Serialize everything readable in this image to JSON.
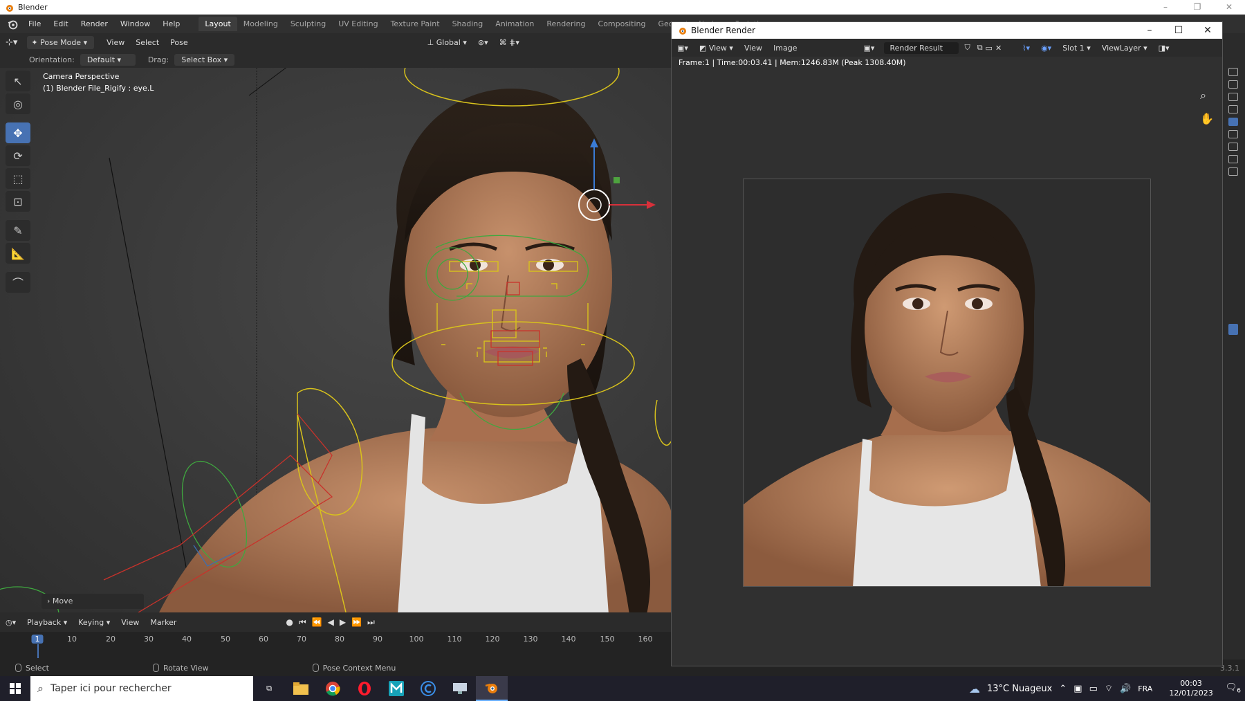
{
  "os": {
    "title": "Blender",
    "controls": [
      "–",
      "❐",
      "✕"
    ]
  },
  "menubar": {
    "menus": [
      "File",
      "Edit",
      "Render",
      "Window",
      "Help"
    ],
    "workspaces": [
      "Layout",
      "Modeling",
      "Sculpting",
      "UV Editing",
      "Texture Paint",
      "Shading",
      "Animation",
      "Rendering",
      "Compositing",
      "Geometry Nodes",
      "Scriptin"
    ],
    "active_workspace": "Layout"
  },
  "viewport": {
    "mode": "Pose Mode",
    "header_menus": [
      "View",
      "Select",
      "Pose"
    ],
    "transform_orientation": "Global",
    "orientation_label": "Orientation:",
    "orientation_value": "Default",
    "drag_label": "Drag:",
    "drag_value": "Select Box",
    "info_line1": "Camera Perspective",
    "info_line2": "(1) Blender File_Rigify : eye.L",
    "last_op": "Move"
  },
  "toolbar": {
    "tools": [
      {
        "name": "select-box-tool",
        "icon": "↖",
        "active": false
      },
      {
        "name": "cursor-tool",
        "icon": "◎",
        "active": false
      },
      {
        "name": "move-tool",
        "icon": "✥",
        "active": true
      },
      {
        "name": "rotate-tool",
        "icon": "⟳",
        "active": false
      },
      {
        "name": "scale-tool",
        "icon": "⬚",
        "active": false
      },
      {
        "name": "transform-tool",
        "icon": "⊡",
        "active": false
      },
      {
        "name": "annotate-tool",
        "icon": "✎",
        "active": false
      },
      {
        "name": "measure-tool",
        "icon": "📐",
        "active": false
      },
      {
        "name": "relax-pose-tool",
        "icon": "⌒",
        "active": false
      }
    ]
  },
  "timeline": {
    "menus": [
      "Playback",
      "Keying",
      "View",
      "Marker"
    ],
    "current_frame": "1",
    "ticks": [
      "10",
      "20",
      "30",
      "40",
      "50",
      "60",
      "70",
      "80",
      "90",
      "100",
      "110",
      "120",
      "130",
      "140",
      "150",
      "160"
    ],
    "controls": [
      "⏮",
      "⏪",
      "◀",
      "▶",
      "⏩",
      "⏭"
    ]
  },
  "statusbar": {
    "select": "Select",
    "rotate": "Rotate View",
    "context": "Pose Context Menu",
    "version": "3.3.1"
  },
  "render_window": {
    "title": "Blender Render",
    "menus": [
      "View",
      "Image"
    ],
    "image_name": "Render Result",
    "slot": "Slot 1",
    "view_layer": "ViewLayer",
    "stats": "Frame:1 | Time:00:03.41 | Mem:1246.83M (Peak 1308.40M)",
    "controls": [
      "–",
      "☐",
      "✕"
    ]
  },
  "taskbar": {
    "search_placeholder": "Taper ici pour rechercher",
    "weather": "13°C Nuageux",
    "language": "FRA",
    "time": "00:03",
    "date": "12/01/2023",
    "notifications": "6"
  },
  "colors": {
    "accent": "#4772b3",
    "rig_yellow": "#d8c21c",
    "rig_green": "#3fa83f",
    "rig_red": "#c8322b"
  }
}
